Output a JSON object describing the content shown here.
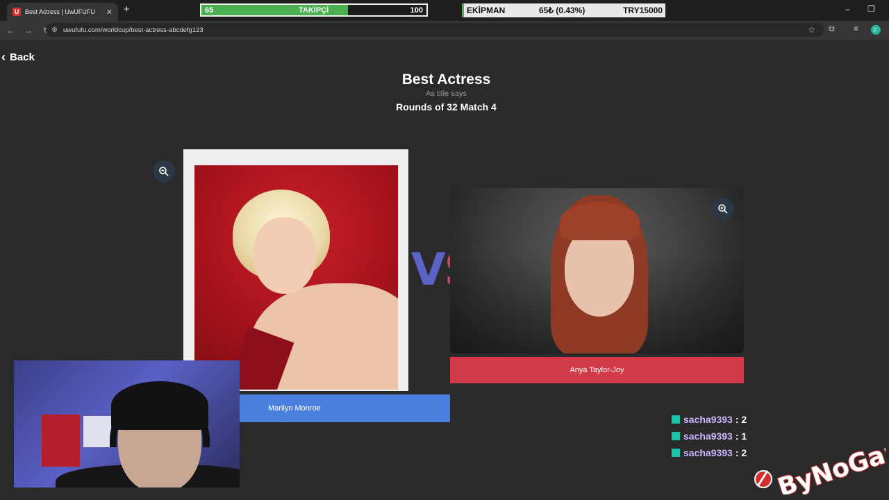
{
  "browser": {
    "tab_title": "Best Actress | UwUFUFU",
    "tab_favicon": "U",
    "url": "uwufufu.com/worldcup/best-actress-abcdefg123",
    "profile_initial": "F"
  },
  "overlay": {
    "follow": {
      "min": "65",
      "label": "TAKİPÇİ",
      "max": "100",
      "progress": 0.65
    },
    "equipment": {
      "label": "EKİPMAN",
      "value": "65₺ (0.43%)",
      "target": "TRY15000"
    }
  },
  "page": {
    "back_label": "Back",
    "title": "Best Actress",
    "subtitle": "As title says",
    "round": "Rounds of 32 Match 4",
    "vs_v": "V",
    "vs_s": "S"
  },
  "contestants": [
    {
      "name": "Marilyn Monroe",
      "color": "#4a7fe0"
    },
    {
      "name": "Anya Taylor-Joy",
      "color": "#d23a47"
    }
  ],
  "chat": [
    {
      "user": "sacha9393",
      "value": "2"
    },
    {
      "user": "sacha9393",
      "value": "1"
    },
    {
      "user": "sacha9393",
      "value": "2"
    }
  ],
  "watermark": "ByNoGam"
}
